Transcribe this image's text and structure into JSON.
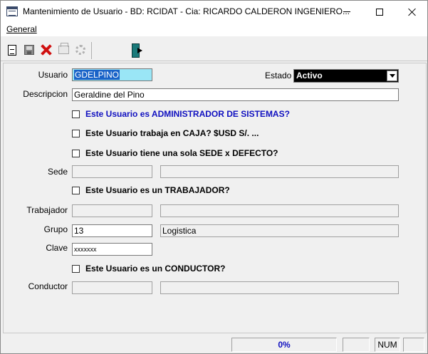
{
  "window": {
    "title": "Mantenimiento de Usuario - BD: RCIDAT - Cia: RICARDO CALDERON INGENIERO...",
    "icon": "app-window-icon"
  },
  "menu": {
    "items": [
      {
        "label": "General"
      }
    ]
  },
  "toolbar": {
    "buttons": [
      {
        "name": "new-document-icon",
        "enabled": true
      },
      {
        "name": "save-icon",
        "enabled": false
      },
      {
        "name": "delete-icon",
        "enabled": true
      },
      {
        "name": "print-icon",
        "enabled": false
      },
      {
        "name": "settings-gear-icon",
        "enabled": false
      },
      {
        "name": "exit-door-icon",
        "enabled": true
      }
    ]
  },
  "form": {
    "usuario": {
      "label": "Usuario",
      "value": "GDELPINO"
    },
    "estado": {
      "label": "Estado",
      "value": "Activo"
    },
    "descripcion": {
      "label": "Descripcion",
      "value": "Geraldine del Pino"
    },
    "chk_admin": {
      "label": "Este Usuario es ADMINISTRADOR DE SISTEMAS?",
      "checked": false
    },
    "chk_caja": {
      "label": "Este Usuario trabaja en CAJA? $USD S/. ...",
      "checked": false
    },
    "chk_sede": {
      "label": "Este Usuario tiene una sola SEDE x DEFECTO?",
      "checked": false
    },
    "sede": {
      "label": "Sede",
      "code": "",
      "name": ""
    },
    "chk_trabajador": {
      "label": "Este Usuario es un TRABAJADOR?",
      "checked": false
    },
    "trabajador": {
      "label": "Trabajador",
      "code": "",
      "name": ""
    },
    "grupo": {
      "label": "Grupo",
      "code": "13",
      "name": "Logistica"
    },
    "clave": {
      "label": "Clave",
      "value": "xxxxxxx"
    },
    "chk_conductor": {
      "label": "Este Usuario es un CONDUCTOR?",
      "checked": false
    },
    "conductor": {
      "label": "Conductor",
      "code": "",
      "name": ""
    }
  },
  "status": {
    "progress": "0%",
    "num": "NUM"
  }
}
